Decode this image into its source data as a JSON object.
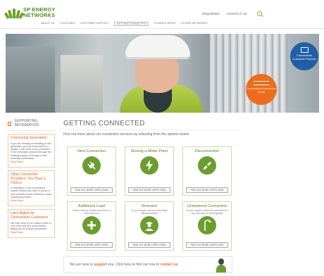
{
  "brand": {
    "line1": "SP ENERGY",
    "line2": "NETWORKS"
  },
  "top_links": [
    "ENQUIRIES",
    "CONTACT US"
  ],
  "nav": [
    "ABOUT US",
    "YOUR AREA",
    "CUSTOMER SUPPORT",
    "GETTING CONNECTED",
    "PLANNED WORK",
    "FUTURE NETWORKS"
  ],
  "hero": {
    "badge_blue": "Connections Customer Process",
    "badge_orange": "Connections Interactive Guide"
  },
  "sidebar": {
    "title": "SUPPORTING INFORMATION",
    "sections": [
      {
        "heading": "Connecting Generation",
        "text": "If you are thinking of installing a new generator, such as wind turbine or similar, it will need to be connected to the electricity network through the existing supply or through a new electricity connection.",
        "more": "Read More"
      },
      {
        "heading": "Other Connection Providers: You Have a Choice",
        "text": "Competition in the connections market means you have a choice in who provides some elements of your connection project.",
        "more": "Read More"
      },
      {
        "heading": "Land Rights for Connections Customers",
        "text": "We may need to run cables under or over land that isn't yours before giving you an supply connection.",
        "more": "Read More"
      }
    ]
  },
  "main": {
    "title": "GETTING CONNECTED",
    "intro": "Find out more about our connection services by selecting from the options below.",
    "cards": [
      {
        "title": "New Connection",
        "desc": "",
        "button": "FIND OUT MORE / APPLY NOW",
        "icon": "plug-icon"
      },
      {
        "title": "Moving a Meter Point",
        "desc": "",
        "button": "FIND OUT MORE / APPLY NOW",
        "icon": "lightning-icon"
      },
      {
        "title": "Disconnection",
        "desc": "",
        "button": "FIND OUT MORE / APPLY NOW",
        "icon": "unplug-icon"
      },
      {
        "title": "Additional Load",
        "desc": "Please read by at least work here's a more ask more",
        "button": "FIND OUT MORE / APPLY NOW",
        "icon": "plus-icon"
      },
      {
        "title": "Diversion",
        "desc": "Do you require and more electricity network diverted",
        "button": "FIND OUT MORE / APPLY NOW",
        "icon": "worker-icon"
      },
      {
        "title": "Unmetered Connection",
        "desc": "Do you require unmetered connection to say new lamp or street lighting",
        "button": "FIND OUT MORE / APPLY NOW",
        "icon": "streetlight-icon"
      }
    ]
  },
  "support": {
    "text_a": "We are here to ",
    "strong_a": "support",
    "text_b": " you. Click here to find out how to ",
    "strong_b": "contact us",
    "text_c": "."
  },
  "colors": {
    "green": "#6a9e2d",
    "orange": "#ef6c1a",
    "blue": "#1f5fa8"
  }
}
